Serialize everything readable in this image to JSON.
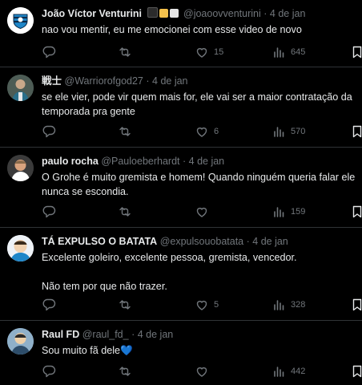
{
  "tweets": [
    {
      "name": "João Víctor Venturini",
      "handle": "@joaoovventurini",
      "date": "4 de jan",
      "text": "nao vou mentir, eu me emocionei com esse video de novo",
      "replies": "",
      "reposts": "",
      "likes": "15",
      "views": "645",
      "avatar_icon": "club-crest-avatar"
    },
    {
      "name": "戦士",
      "handle": "@Warriorofgod27",
      "date": "4 de jan",
      "text": "se ele vier, pode vir quem mais for, ele vai ser a maior contratação da temporada pra gente",
      "replies": "",
      "reposts": "",
      "likes": "6",
      "views": "570",
      "avatar_icon": "player-photo-avatar"
    },
    {
      "name": "paulo rocha",
      "handle": "@Pauloeberhardt",
      "date": "4 de jan",
      "text": "O Grohe é muito gremista e homem! Quando ninguém queria falar ele nunca se escondia.",
      "replies": "",
      "reposts": "",
      "likes": "",
      "views": "159",
      "avatar_icon": "person-photo-avatar"
    },
    {
      "name": "TÁ EXPULSO O BATATA",
      "handle": "@expulsouobatata",
      "date": "4 de jan",
      "text": "Excelente goleiro, excelente pessoa, gremista, vencedor.\n\nNão tem por que não trazer.",
      "replies": "",
      "reposts": "",
      "likes": "5",
      "views": "328",
      "avatar_icon": "cartoon-avatar"
    },
    {
      "name": "Raul FD",
      "handle": "@raul_fd_",
      "date": "4 de jan",
      "text": "Sou muito fã dele💙",
      "replies": "",
      "reposts": "",
      "likes": "",
      "views": "442",
      "avatar_icon": "cartoon-avatar-2"
    }
  ],
  "separator": "·",
  "colors": {
    "background": "#000000",
    "text": "#e7e9ea",
    "muted": "#71767b",
    "divider": "#2f3336"
  },
  "badges": [
    "black-square",
    "yellow-square",
    "white-square"
  ]
}
